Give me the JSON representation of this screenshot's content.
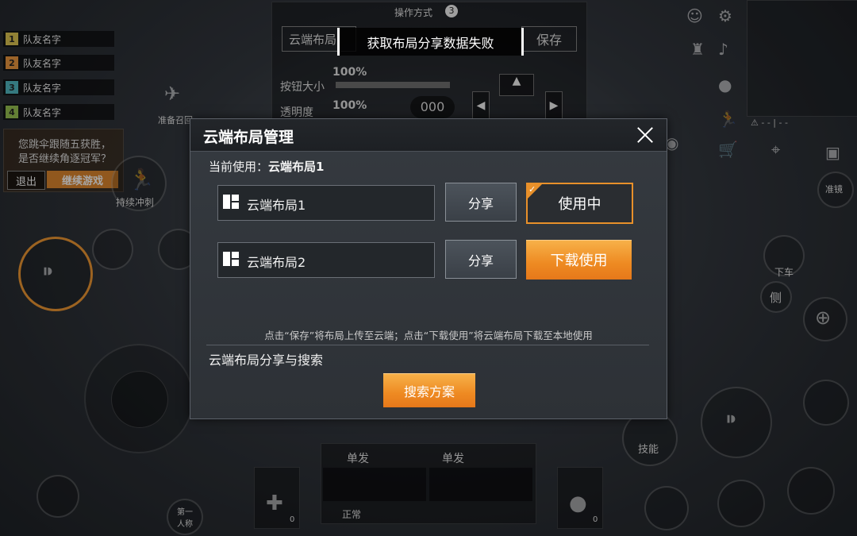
{
  "background": {
    "teammates": [
      {
        "num": "1",
        "name": "队友名字",
        "color": "#c9b34a"
      },
      {
        "num": "2",
        "name": "队友名字",
        "color": "#d68a3a"
      },
      {
        "num": "3",
        "name": "队友名字",
        "color": "#4aa8b0"
      },
      {
        "num": "4",
        "name": "队友名字",
        "color": "#8ab04a"
      }
    ],
    "operation_mode_label": "操作方式",
    "operation_mode_badge": "3",
    "top_layout_tab": "云端布局",
    "top_save_label": "保存",
    "button_size_label": "按钮大小",
    "button_size_value": "100%",
    "opacity_label": "透明度",
    "opacity_value": "100%",
    "ready_label": "准备召回",
    "continue_prompt_line1": "您跳伞跟随五获胜，",
    "continue_prompt_line2": "是否继续角逐冠军？",
    "exit_label": "退出",
    "continue_label": "继续游戏",
    "sprint_label": "持续冲刺",
    "scope_label": "准镜",
    "vehicle_exit_label": "下车",
    "lean_label": "侧",
    "skill_label": "技能",
    "fire_mode_left": "单发",
    "fire_mode_right": "单发",
    "status_label": "正常",
    "perspective_label": "第一人称",
    "medkit_count": "0",
    "grenade_count": "0",
    "ammo_display": "000"
  },
  "toast": {
    "message": "获取布局分享数据失败"
  },
  "modal": {
    "title": "云端布局管理",
    "current_prefix": "当前使用：",
    "current_value": "云端布局1",
    "layouts": [
      {
        "name": "云端布局1",
        "share_label": "分享",
        "action_label": "使用中",
        "state": "in-use"
      },
      {
        "name": "云端布局2",
        "share_label": "分享",
        "action_label": "下载使用",
        "state": "download"
      }
    ],
    "hint": "点击“保存”将布局上传至云端；点击“下载使用”将云端布局下载至本地使用",
    "section_title": "云端布局分享与搜索",
    "search_label": "搜索方案"
  },
  "colors": {
    "accent_orange": "#ee8a22",
    "modal_bg": "#353a40",
    "header_bg": "#1d2024"
  },
  "icons": [
    "close-icon",
    "layout-grid-icon",
    "check-icon",
    "settings-gear-icon",
    "emoji-icon",
    "speaker-icon",
    "mic-icon",
    "sprint-icon",
    "cart-icon",
    "eye-icon",
    "location-pin-icon",
    "chat-icon",
    "crosshair-icon",
    "bullet-icon",
    "medkit-icon",
    "grenade-icon",
    "drone-icon"
  ]
}
